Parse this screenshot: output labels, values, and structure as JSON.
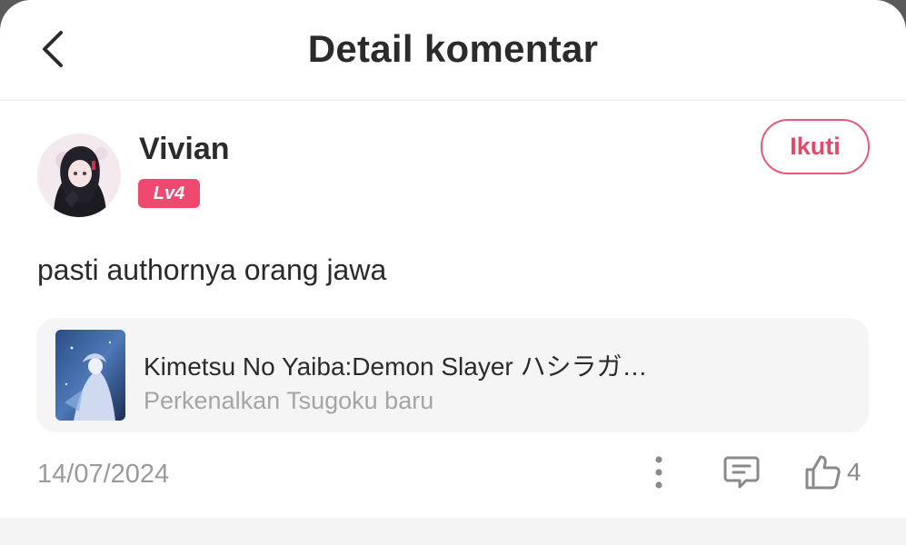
{
  "header": {
    "title": "Detail komentar",
    "back_icon": "chevron-left-icon"
  },
  "user": {
    "name": "Vivian",
    "level": "Lv4",
    "follow_label": "Ikuti"
  },
  "comment": {
    "text": "pasti authornya orang jawa",
    "date": "14/07/2024",
    "like_count": "4"
  },
  "book": {
    "title": "Kimetsu No Yaiba:Demon Slayer ハシラガ…",
    "subtitle": "Perkenalkan Tsugoku baru"
  },
  "icons": {
    "more": "more-vertical-icon",
    "reply": "comment-icon",
    "like": "thumbs-up-icon"
  },
  "colors": {
    "accent": "#f0496f",
    "follow_border": "#e85a77",
    "muted_text": "#9a9a9a"
  }
}
